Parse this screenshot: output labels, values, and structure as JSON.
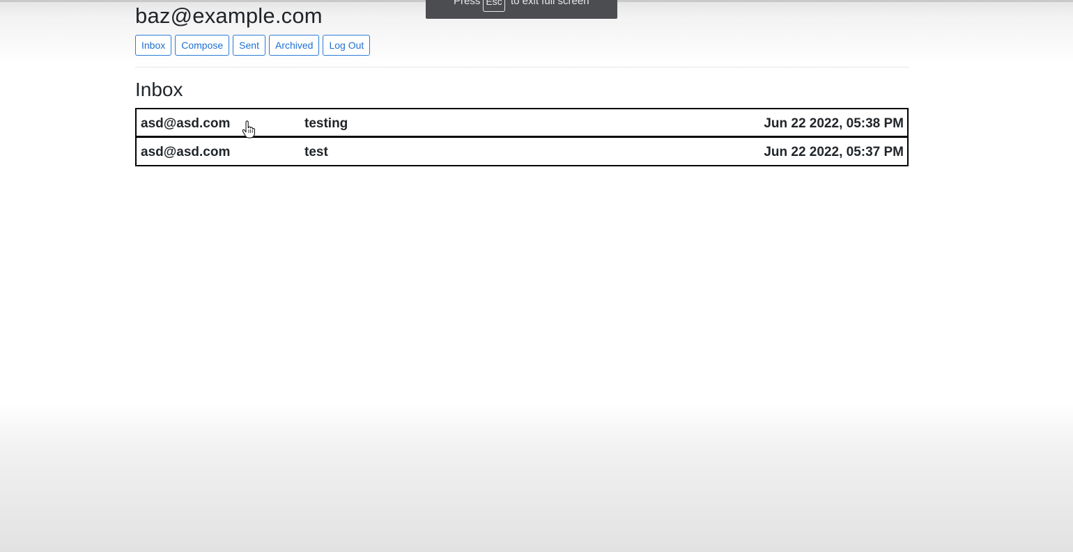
{
  "fullscreen_notice": {
    "prefix": "Press",
    "key": "Esc",
    "suffix": "to exit full screen"
  },
  "header": {
    "user_email": "baz@example.com"
  },
  "nav": {
    "buttons": [
      {
        "label": "Inbox"
      },
      {
        "label": "Compose"
      },
      {
        "label": "Sent"
      },
      {
        "label": "Archived"
      },
      {
        "label": "Log Out"
      }
    ]
  },
  "mailbox": {
    "title": "Inbox",
    "emails": [
      {
        "sender": "asd@asd.com",
        "subject": "testing",
        "timestamp": "Jun 22 2022, 05:38 PM"
      },
      {
        "sender": "asd@asd.com",
        "subject": "test",
        "timestamp": "Jun 22 2022, 05:37 PM"
      }
    ]
  },
  "colors": {
    "button_accent": "#2a7bd6",
    "text": "#212529",
    "row_border": "#000000",
    "banner_bg": "#4b4d51"
  },
  "icons": {
    "cursor": "hand-pointer-icon"
  }
}
